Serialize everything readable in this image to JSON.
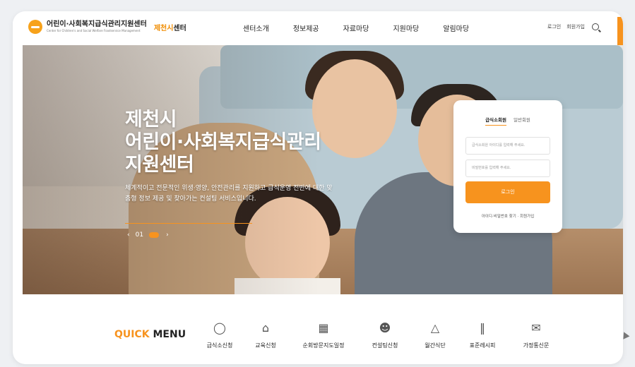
{
  "header": {
    "logo_title": "어린이·사회복지급식관리지원센터",
    "logo_subtitle": "Center for Children's and Social Welfare Foodservice Management",
    "logo_city": "제천시",
    "logo_center": "센터"
  },
  "nav": {
    "items": [
      "센터소개",
      "정보제공",
      "자료마당",
      "지원마당",
      "알림마당"
    ]
  },
  "util": {
    "login": "로그인",
    "signup": "회원가입"
  },
  "hero": {
    "title_line1": "제천시",
    "title_line2": "어린이·사회복지급식관리",
    "title_line3": "지원센터",
    "description": "체계적이고 전문적인 위생·영양, 안전관리를 지원하고 급식운영 전반에 대한 맞춤형 정보 제공 및 찾아가는 컨설팅 서비스입니다.",
    "prev": "‹",
    "next": "›",
    "counter": "01"
  },
  "login": {
    "tab_facility": "급식소회원",
    "tab_general": "일반회원",
    "id_placeholder": "급식소회원 아이디를 입력해 주세요.",
    "pw_placeholder": "비밀번호를 입력해 주세요.",
    "button": "로그인",
    "links": "아이디·비밀번호 찾기 · 회원가입"
  },
  "quick_menu": {
    "title_accent": "QUICK",
    "title_rest": " MENU",
    "items": [
      {
        "label": "급식소신청",
        "icon": "cup-icon"
      },
      {
        "label": "교육신청",
        "icon": "building-icon"
      },
      {
        "label": "순회방문지도일정",
        "icon": "bus-icon"
      },
      {
        "label": "컨설팅신청",
        "icon": "person-icon"
      },
      {
        "label": "월간식단",
        "icon": "cloche-icon"
      },
      {
        "label": "표준레시피",
        "icon": "utensils-icon"
      },
      {
        "label": "가정통신문",
        "icon": "mail-icon"
      }
    ]
  }
}
